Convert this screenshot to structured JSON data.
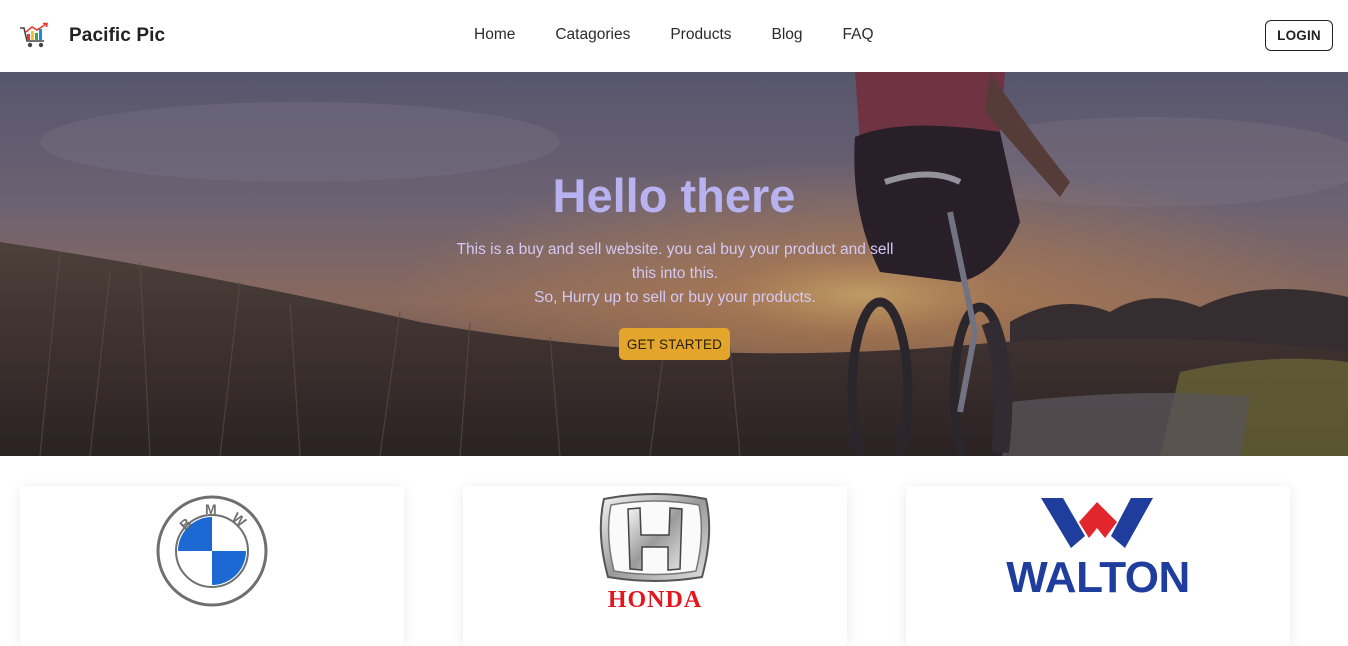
{
  "header": {
    "brand_name": "Pacific Pic",
    "logo_icon": "shopping-cart-chart-icon",
    "nav": [
      {
        "label": "Home"
      },
      {
        "label": "Catagories"
      },
      {
        "label": "Products"
      },
      {
        "label": "Blog"
      },
      {
        "label": "FAQ"
      }
    ],
    "login_label": "LOGIN"
  },
  "hero": {
    "title": "Hello there",
    "text_line1": "This is a buy and sell website. you cal buy your product and sell this into this.",
    "text_line2": "So, Hurry up to sell or buy your products.",
    "cta_label": "GET STARTED",
    "background": "sunset-cyclist-photo",
    "colors": {
      "title": "#b8b2f0",
      "cta": "#e3a52c"
    }
  },
  "brands": [
    {
      "name": "BMW",
      "logo_text": "BMW",
      "icon": "bmw-logo"
    },
    {
      "name": "HONDA",
      "logo_text": "HONDA",
      "icon": "honda-logo"
    },
    {
      "name": "WALTON",
      "logo_text": "WALTON",
      "icon": "walton-logo"
    }
  ]
}
